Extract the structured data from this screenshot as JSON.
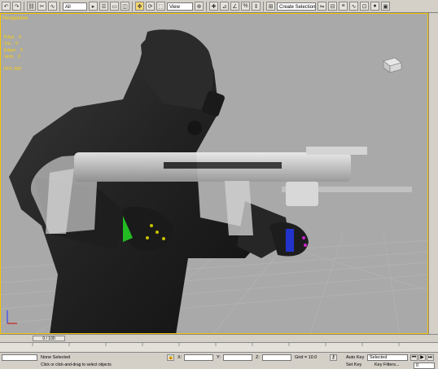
{
  "toolbar": {
    "selection_filter": "All",
    "reference_coord": "View",
    "named_selection": "Create Selection Set"
  },
  "viewport": {
    "label": "Perspective",
    "stats": [
      {
        "label": "Polys",
        "value": "0"
      },
      {
        "label": "Tris",
        "value": "0"
      },
      {
        "label": "Edges",
        "value": "0"
      },
      {
        "label": "Verts",
        "value": "0"
      }
    ],
    "fps": "FPS: 000"
  },
  "timeline": {
    "frame_counter": "0 / 100"
  },
  "status": {
    "selection": "None Selected",
    "prompt": "Click or click-and-drag to select objects",
    "x_label": "X:",
    "x_value": "",
    "y_label": "Y:",
    "y_value": "",
    "z_label": "Z:",
    "z_value": "",
    "grid": "Grid = 10.0",
    "auto_key": "Auto Key",
    "set_key": "Set Key",
    "key_mode": "Selected",
    "key_filters": "Key Filters...",
    "frame": "0"
  },
  "colors": {
    "viewport_bg": "#a9a9a9",
    "active_border": "#f5c400",
    "ui_panel": "#d4d0c8"
  }
}
